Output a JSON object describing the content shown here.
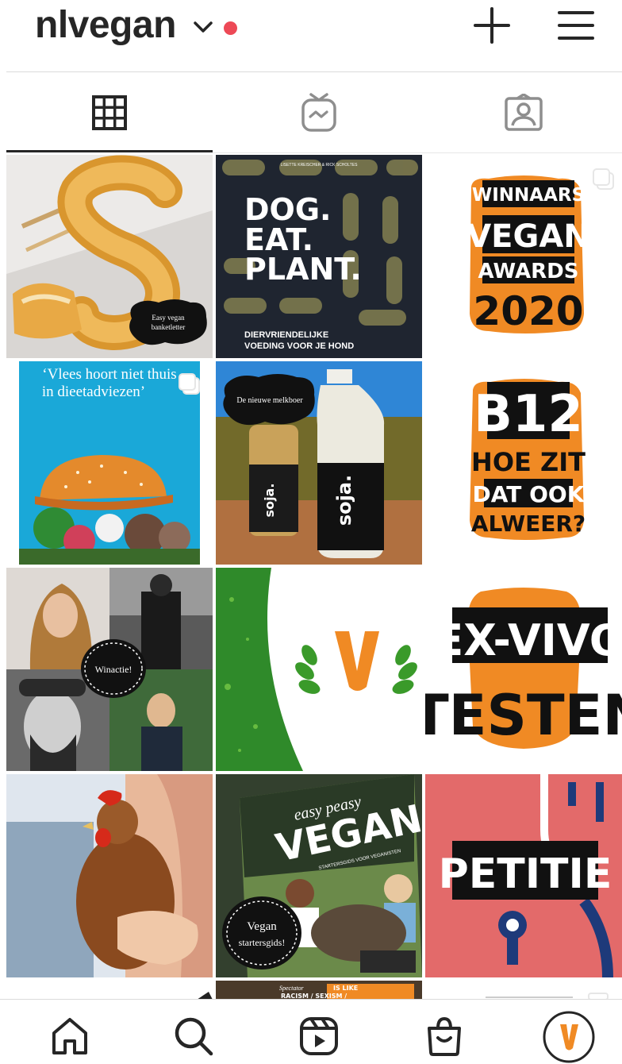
{
  "header": {
    "username": "nlvegan",
    "icons": [
      "chevron-down-icon",
      "notification-dot",
      "plus-icon",
      "menu-icon"
    ]
  },
  "tabs": [
    {
      "name": "grid-icon",
      "active": true
    },
    {
      "name": "igtv-icon",
      "active": false
    },
    {
      "name": "tagged-icon",
      "active": false
    }
  ],
  "posts": {
    "p1": {
      "badge": [
        "Easy vegan",
        "banketletter"
      ]
    },
    "p2": {
      "top": "LISETTE KREISCHER & RICK SCHOLTES",
      "title": [
        "DOG.",
        "EAT.",
        "PLANT."
      ],
      "sub": [
        "DIERVRIENDELIJKE",
        "VOEDING VOOR JE HOND"
      ]
    },
    "p3": {
      "lines": [
        "WINNAARS",
        "VEGAN",
        "AWARDS",
        "2020"
      ],
      "multi": true
    },
    "p4": {
      "quote": [
        "‘Vlees hoort niet thuis",
        "in dieetadviezen’"
      ],
      "multi": true
    },
    "p5": {
      "badge": "De nieuwe melkboer",
      "brand": "soja."
    },
    "p6": {
      "lines": [
        "B12",
        "HOE ZIT",
        "DAT OOK",
        "ALWEER?"
      ]
    },
    "p7": {
      "badge": "Winactie!"
    },
    "p8": {
      "letter": "V"
    },
    "p9": {
      "lines": [
        "EX-VIVO",
        "TESTEN"
      ]
    },
    "p10": {},
    "p11": {
      "script": "easy peasy",
      "title": "VEGAN",
      "sub": "STARTERSGIDS VOOR VEGANISTEN",
      "badge": [
        "Vegan",
        "startersgids!"
      ]
    },
    "p12": {
      "label": "PETITIE"
    },
    "p13": {},
    "p14": {
      "text": [
        "Spectator",
        "IS LIKE",
        "RACISM / SEXISM /"
      ]
    },
    "p15": {}
  },
  "bottom_nav": [
    {
      "name": "home-icon"
    },
    {
      "name": "search-icon"
    },
    {
      "name": "reels-icon"
    },
    {
      "name": "shop-icon"
    },
    {
      "name": "profile-avatar",
      "letter": "V"
    }
  ],
  "colors": {
    "accent_orange": "#f08a24",
    "notification_red": "#ed4956",
    "petitie_bg": "#e36a6a",
    "dark": "#262626"
  }
}
